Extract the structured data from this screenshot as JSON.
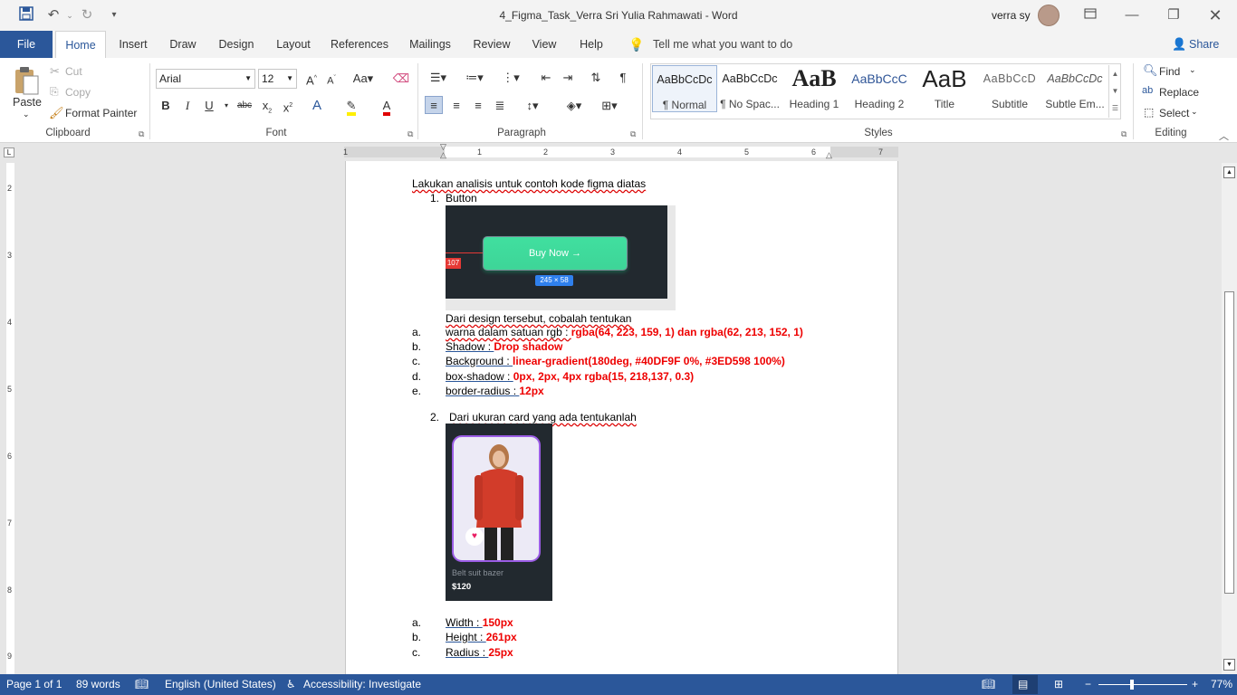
{
  "window": {
    "title": "4_Figma_Task_Verra Sri Yulia Rahmawati  -  Word",
    "user": "verra sy"
  },
  "tabs": [
    "File",
    "Home",
    "Insert",
    "Draw",
    "Design",
    "Layout",
    "References",
    "Mailings",
    "Review",
    "View",
    "Help"
  ],
  "tell_me": "Tell me what you want to do",
  "share": "Share",
  "clipboard": {
    "paste": "Paste",
    "cut": "Cut",
    "copy": "Copy",
    "format_painter": "Format Painter",
    "label": "Clipboard"
  },
  "font": {
    "name": "Arial",
    "size": "12",
    "label": "Font"
  },
  "paragraph": {
    "label": "Paragraph"
  },
  "styles": {
    "label": "Styles",
    "items": [
      {
        "preview": "AaBbCcDc",
        "name": "¶ Normal"
      },
      {
        "preview": "AaBbCcDc",
        "name": "¶ No Spac..."
      },
      {
        "preview": "AaB",
        "name": "Heading 1"
      },
      {
        "preview": "AaBbCcC",
        "name": "Heading 2"
      },
      {
        "preview": "AaB",
        "name": "Title"
      },
      {
        "preview": "AaBbCcD",
        "name": "Subtitle"
      },
      {
        "preview": "AaBbCcDc",
        "name": "Subtle Em..."
      }
    ]
  },
  "editing": {
    "find": "Find",
    "replace": "Replace",
    "select": "Select",
    "label": "Editing"
  },
  "ruler_numbers": [
    "1",
    "1",
    "2",
    "3",
    "4",
    "5",
    "6",
    "7"
  ],
  "vruler_numbers": [
    "2",
    "3",
    "4",
    "5",
    "6",
    "7",
    "8",
    "9"
  ],
  "doc": {
    "intro": "Lakukan analisis untuk contoh kode figma diatas",
    "item1_num": "1.",
    "item1": "Button",
    "button_img": {
      "label": "Buy Now →",
      "size": "245 × 58",
      "tag": "107"
    },
    "q_intro": "Dari design tersebut, cobalah tentukan",
    "list_a": [
      {
        "m": "a.",
        "k": "warna dalam satuan rgb : ",
        "v": "rgba(64, 223, 159, 1) dan rgba(62, 213, 152, 1)"
      },
      {
        "m": "b.",
        "k": "Shadow : ",
        "v": "Drop shadow"
      },
      {
        "m": "c.",
        "k": "Background : ",
        "v": "linear-gradient(180deg, #40DF9F 0%, #3ED598 100%)"
      },
      {
        "m": "d.",
        "k": "box-shadow : ",
        "v": "0px, 2px, 4px rgba(15, 218,137, 0.3)"
      },
      {
        "m": "e.",
        "k": "border-radius : ",
        "v": "12px"
      }
    ],
    "item2_num": "2.",
    "item2": "Dari ukuran card yang ada tentukanlah",
    "card_img": {
      "name": "Belt suit bazer",
      "price": "$120"
    },
    "list_b": [
      {
        "m": "a.",
        "k": "Width : ",
        "v": "150px"
      },
      {
        "m": "b.",
        "k": "Height : ",
        "v": "261px"
      },
      {
        "m": "c.",
        "k": "Radius : ",
        "v": "25px"
      }
    ]
  },
  "status": {
    "page": "Page 1 of 1",
    "words": "89 words",
    "language": "English (United States)",
    "accessibility": "Accessibility: Investigate",
    "zoom": "77%"
  },
  "colors": {
    "brand": "#2b579a",
    "button_green": "#40DF9F",
    "red_text": "#e00000",
    "card_bg": "#22292f"
  }
}
